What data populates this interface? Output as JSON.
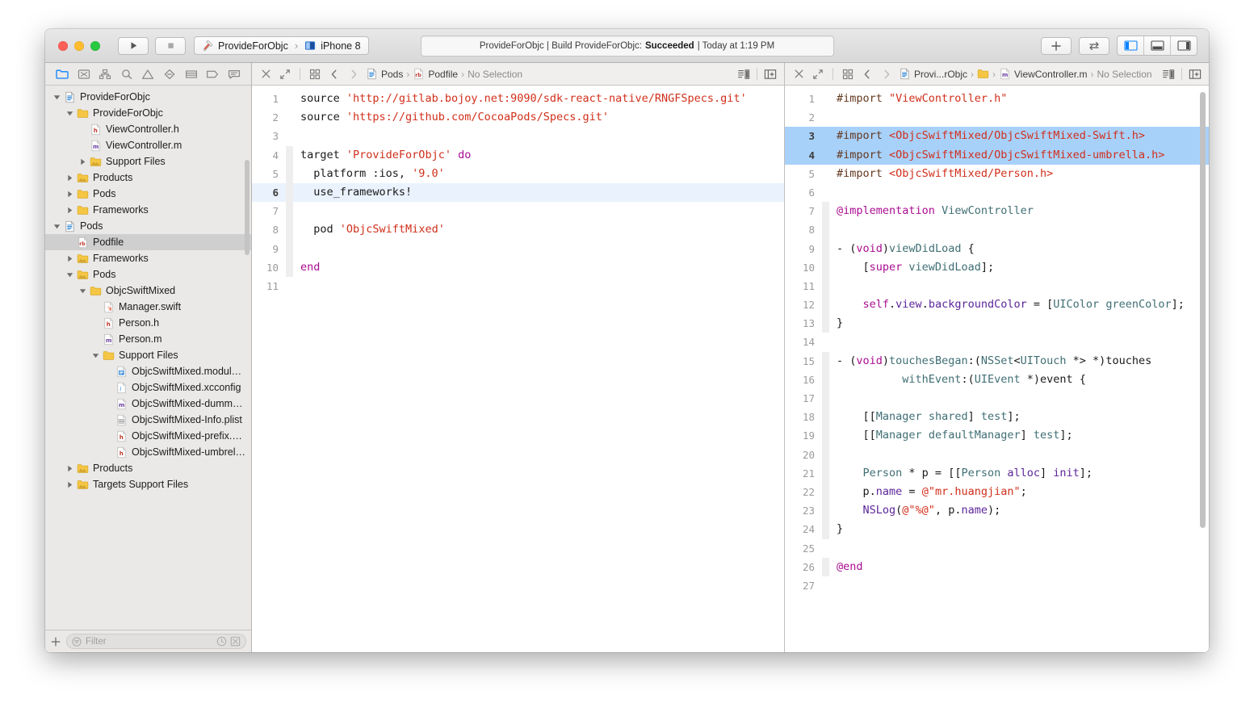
{
  "window": {
    "title": "ProvideForObjc",
    "traffic_lights": [
      "close-button",
      "minimize-button",
      "zoom-button"
    ]
  },
  "toolbar": {
    "run_label": "Run",
    "stop_label": "Stop",
    "scheme": {
      "project": "ProvideForObjc",
      "separator": "›",
      "destination": "iPhone 8"
    },
    "status": {
      "prefix": "ProvideForObjc | Build ProvideForObjc:",
      "result": "Succeeded",
      "suffix": "| Today at 1:19 PM"
    },
    "add_label": "+",
    "editor_buttons": [
      "navigator-toggle",
      "debug-toggle",
      "utilities-toggle"
    ]
  },
  "navigator": {
    "toolbar_icons": [
      "project-navigator-icon",
      "source-control-navigator-icon",
      "symbol-navigator-icon",
      "find-navigator-icon",
      "issue-navigator-icon",
      "test-navigator-icon",
      "debug-navigator-icon",
      "breakpoint-navigator-icon",
      "report-navigator-icon"
    ],
    "tree": [
      {
        "label": "ProvideForObjc",
        "depth": 0,
        "twisty": "open",
        "icon": "project",
        "selected": false
      },
      {
        "label": "ProvideForObjc",
        "depth": 1,
        "twisty": "open",
        "icon": "folder",
        "selected": false
      },
      {
        "label": "ViewController.h",
        "depth": 2,
        "twisty": "none",
        "icon": "header",
        "selected": false
      },
      {
        "label": "ViewController.m",
        "depth": 2,
        "twisty": "none",
        "icon": "objc",
        "selected": false
      },
      {
        "label": "Support Files",
        "depth": 2,
        "twisty": "closed",
        "icon": "folder-g",
        "selected": false
      },
      {
        "label": "Products",
        "depth": 1,
        "twisty": "closed",
        "icon": "folder-g",
        "selected": false
      },
      {
        "label": "Pods",
        "depth": 1,
        "twisty": "closed",
        "icon": "folder",
        "selected": false
      },
      {
        "label": "Frameworks",
        "depth": 1,
        "twisty": "closed",
        "icon": "folder",
        "selected": false
      },
      {
        "label": "Pods",
        "depth": 0,
        "twisty": "open",
        "icon": "project",
        "selected": false
      },
      {
        "label": "Podfile",
        "depth": 1,
        "twisty": "none",
        "icon": "ruby",
        "selected": true
      },
      {
        "label": "Frameworks",
        "depth": 1,
        "twisty": "closed",
        "icon": "folder-g",
        "selected": false
      },
      {
        "label": "Pods",
        "depth": 1,
        "twisty": "open",
        "icon": "folder-g",
        "selected": false
      },
      {
        "label": "ObjcSwiftMixed",
        "depth": 2,
        "twisty": "open",
        "icon": "folder",
        "selected": false
      },
      {
        "label": "Manager.swift",
        "depth": 3,
        "twisty": "none",
        "icon": "swift",
        "selected": false
      },
      {
        "label": "Person.h",
        "depth": 3,
        "twisty": "none",
        "icon": "header",
        "selected": false
      },
      {
        "label": "Person.m",
        "depth": 3,
        "twisty": "none",
        "icon": "objc",
        "selected": false
      },
      {
        "label": "Support Files",
        "depth": 3,
        "twisty": "open",
        "icon": "folder",
        "selected": false
      },
      {
        "label": "ObjcSwiftMixed.modulemap",
        "depth": 4,
        "twisty": "none",
        "icon": "module",
        "selected": false
      },
      {
        "label": "ObjcSwiftMixed.xcconfig",
        "depth": 4,
        "twisty": "none",
        "icon": "xcconfig",
        "selected": false
      },
      {
        "label": "ObjcSwiftMixed-dummy.m",
        "depth": 4,
        "twisty": "none",
        "icon": "objc",
        "selected": false
      },
      {
        "label": "ObjcSwiftMixed-Info.plist",
        "depth": 4,
        "twisty": "none",
        "icon": "plist",
        "selected": false
      },
      {
        "label": "ObjcSwiftMixed-prefix.pch",
        "depth": 4,
        "twisty": "none",
        "icon": "header",
        "selected": false
      },
      {
        "label": "ObjcSwiftMixed-umbrella.h",
        "depth": 4,
        "twisty": "none",
        "icon": "header",
        "selected": false
      },
      {
        "label": "Products",
        "depth": 1,
        "twisty": "closed",
        "icon": "folder-g",
        "selected": false
      },
      {
        "label": "Targets Support Files",
        "depth": 1,
        "twisty": "closed",
        "icon": "folder-g",
        "selected": false
      }
    ],
    "filter": {
      "placeholder": "Filter",
      "add_label": "+",
      "recent_icon": "clock-icon",
      "source-control_icon": "source-control-filter-icon"
    }
  },
  "left_editor": {
    "jumpbar": {
      "close_icon": "close-icon",
      "expand_icon": "expand-icon",
      "related_icon": "related-items-icon",
      "back_icon": "chevron-left-icon",
      "forward_icon": "chevron-right-icon",
      "crumbs": [
        {
          "label": "Pods",
          "icon": "project"
        },
        {
          "label": "Podfile",
          "icon": "ruby"
        },
        {
          "label": "No Selection",
          "icon": "none"
        }
      ],
      "assistant_icon": "minimap-icon",
      "split_icon": "add-editor-icon"
    },
    "filename": "Podfile",
    "lines": [
      {
        "n": 1,
        "hl": false,
        "fold": false,
        "tokens": [
          {
            "t": "source ",
            "c": "plain"
          },
          {
            "t": "'http://gitlab.bojoy.net:9090/sdk-react-native/RNGFSpecs.git'",
            "c": "str"
          }
        ]
      },
      {
        "n": 2,
        "hl": false,
        "fold": false,
        "tokens": [
          {
            "t": "source ",
            "c": "plain"
          },
          {
            "t": "'https://github.com/CocoaPods/Specs.git'",
            "c": "str"
          }
        ]
      },
      {
        "n": 3,
        "hl": false,
        "fold": false,
        "tokens": []
      },
      {
        "n": 4,
        "hl": false,
        "fold": true,
        "tokens": [
          {
            "t": "target ",
            "c": "plain"
          },
          {
            "t": "'ProvideForObjc'",
            "c": "str"
          },
          {
            "t": " ",
            "c": "plain"
          },
          {
            "t": "do",
            "c": "kw"
          }
        ]
      },
      {
        "n": 5,
        "hl": false,
        "fold": true,
        "tokens": [
          {
            "t": "  platform :ios, ",
            "c": "plain"
          },
          {
            "t": "'9.0'",
            "c": "str"
          }
        ]
      },
      {
        "n": 6,
        "hl": true,
        "fold": true,
        "tokens": [
          {
            "t": "  use_frameworks!",
            "c": "plain"
          }
        ]
      },
      {
        "n": 7,
        "hl": false,
        "fold": true,
        "tokens": []
      },
      {
        "n": 8,
        "hl": false,
        "fold": true,
        "tokens": [
          {
            "t": "  pod ",
            "c": "plain"
          },
          {
            "t": "'ObjcSwiftMixed'",
            "c": "str"
          }
        ]
      },
      {
        "n": 9,
        "hl": false,
        "fold": true,
        "tokens": []
      },
      {
        "n": 10,
        "hl": false,
        "fold": true,
        "tokens": [
          {
            "t": "end",
            "c": "kw"
          }
        ]
      },
      {
        "n": 11,
        "hl": false,
        "fold": false,
        "tokens": []
      }
    ]
  },
  "right_editor": {
    "jumpbar": {
      "close_icon": "close-icon",
      "expand_icon": "expand-icon",
      "related_icon": "related-items-icon",
      "back_icon": "chevron-left-icon",
      "forward_icon": "chevron-right-icon",
      "crumbs": [
        {
          "label": "Provi...rObjc",
          "icon": "project"
        },
        {
          "label": "",
          "icon": "folder"
        },
        {
          "label": "ViewController.m",
          "icon": "objc"
        },
        {
          "label": "No Selection",
          "icon": "none"
        }
      ],
      "assistant_icon": "minimap-icon",
      "split_icon": "add-editor-icon"
    },
    "filename": "ViewController.m",
    "lines": [
      {
        "n": 1,
        "sel": false,
        "fold": false,
        "bold": false,
        "tokens": [
          {
            "t": "#import ",
            "c": "pre"
          },
          {
            "t": "\"ViewController.h\"",
            "c": "str"
          }
        ]
      },
      {
        "n": 2,
        "sel": false,
        "fold": false,
        "bold": false,
        "tokens": []
      },
      {
        "n": 3,
        "sel": true,
        "fold": false,
        "bold": true,
        "tokens": [
          {
            "t": "#import ",
            "c": "pre"
          },
          {
            "t": "<ObjcSwiftMixed/ObjcSwiftMixed-Swift.h>",
            "c": "str"
          }
        ]
      },
      {
        "n": 4,
        "sel": true,
        "fold": false,
        "bold": true,
        "tokens": [
          {
            "t": "#import ",
            "c": "pre"
          },
          {
            "t": "<ObjcSwiftMixed/ObjcSwiftMixed-umbrella.h>",
            "c": "str"
          }
        ]
      },
      {
        "n": 5,
        "sel": false,
        "fold": false,
        "bold": false,
        "tokens": [
          {
            "t": "#import ",
            "c": "pre"
          },
          {
            "t": "<ObjcSwiftMixed/Person.h>",
            "c": "str"
          }
        ]
      },
      {
        "n": 6,
        "sel": false,
        "fold": false,
        "bold": false,
        "tokens": []
      },
      {
        "n": 7,
        "sel": false,
        "fold": true,
        "bold": false,
        "tokens": [
          {
            "t": "@implementation",
            "c": "kw"
          },
          {
            "t": " ",
            "c": "plain"
          },
          {
            "t": "ViewController",
            "c": "type"
          }
        ]
      },
      {
        "n": 8,
        "sel": false,
        "fold": true,
        "bold": false,
        "tokens": []
      },
      {
        "n": 9,
        "sel": false,
        "fold": true,
        "bold": false,
        "tokens": [
          {
            "t": "- (",
            "c": "plain"
          },
          {
            "t": "void",
            "c": "kw"
          },
          {
            "t": ")",
            "c": "plain"
          },
          {
            "t": "viewDidLoad",
            "c": "type"
          },
          {
            "t": " {",
            "c": "plain"
          }
        ]
      },
      {
        "n": 10,
        "sel": false,
        "fold": true,
        "bold": false,
        "tokens": [
          {
            "t": "    [",
            "c": "plain"
          },
          {
            "t": "super",
            "c": "kw"
          },
          {
            "t": " ",
            "c": "plain"
          },
          {
            "t": "viewDidLoad",
            "c": "type"
          },
          {
            "t": "];",
            "c": "plain"
          }
        ]
      },
      {
        "n": 11,
        "sel": false,
        "fold": true,
        "bold": false,
        "tokens": []
      },
      {
        "n": 12,
        "sel": false,
        "fold": true,
        "bold": false,
        "tokens": [
          {
            "t": "    ",
            "c": "plain"
          },
          {
            "t": "self",
            "c": "kw"
          },
          {
            "t": ".",
            "c": "plain"
          },
          {
            "t": "view",
            "c": "cls"
          },
          {
            "t": ".",
            "c": "plain"
          },
          {
            "t": "backgroundColor",
            "c": "cls"
          },
          {
            "t": " = [",
            "c": "plain"
          },
          {
            "t": "UIColor",
            "c": "type"
          },
          {
            "t": " ",
            "c": "plain"
          },
          {
            "t": "greenColor",
            "c": "type"
          },
          {
            "t": "];",
            "c": "plain"
          }
        ]
      },
      {
        "n": 13,
        "sel": false,
        "fold": true,
        "bold": false,
        "tokens": [
          {
            "t": "}",
            "c": "plain"
          }
        ]
      },
      {
        "n": 14,
        "sel": false,
        "fold": false,
        "bold": false,
        "tokens": []
      },
      {
        "n": 15,
        "sel": false,
        "fold": true,
        "bold": false,
        "tokens": [
          {
            "t": "- (",
            "c": "plain"
          },
          {
            "t": "void",
            "c": "kw"
          },
          {
            "t": ")",
            "c": "plain"
          },
          {
            "t": "touchesBegan",
            "c": "type"
          },
          {
            "t": ":(",
            "c": "plain"
          },
          {
            "t": "NSSet",
            "c": "type"
          },
          {
            "t": "<",
            "c": "plain"
          },
          {
            "t": "UITouch",
            "c": "type"
          },
          {
            "t": " *> *)touches",
            "c": "plain"
          }
        ]
      },
      {
        "n": 16,
        "sel": false,
        "fold": true,
        "bold": false,
        "tokens": [
          {
            "t": "          ",
            "c": "plain"
          },
          {
            "t": "withEvent",
            "c": "type"
          },
          {
            "t": ":(",
            "c": "plain"
          },
          {
            "t": "UIEvent",
            "c": "type"
          },
          {
            "t": " *)event {",
            "c": "plain"
          }
        ]
      },
      {
        "n": 17,
        "sel": false,
        "fold": true,
        "bold": false,
        "tokens": []
      },
      {
        "n": 18,
        "sel": false,
        "fold": true,
        "bold": false,
        "tokens": [
          {
            "t": "    [[",
            "c": "plain"
          },
          {
            "t": "Manager",
            "c": "type"
          },
          {
            "t": " ",
            "c": "plain"
          },
          {
            "t": "shared",
            "c": "type"
          },
          {
            "t": "] ",
            "c": "plain"
          },
          {
            "t": "test",
            "c": "type"
          },
          {
            "t": "];",
            "c": "plain"
          }
        ]
      },
      {
        "n": 19,
        "sel": false,
        "fold": true,
        "bold": false,
        "tokens": [
          {
            "t": "    [[",
            "c": "plain"
          },
          {
            "t": "Manager",
            "c": "type"
          },
          {
            "t": " ",
            "c": "plain"
          },
          {
            "t": "defaultManager",
            "c": "type"
          },
          {
            "t": "] ",
            "c": "plain"
          },
          {
            "t": "test",
            "c": "type"
          },
          {
            "t": "];",
            "c": "plain"
          }
        ]
      },
      {
        "n": 20,
        "sel": false,
        "fold": true,
        "bold": false,
        "tokens": []
      },
      {
        "n": 21,
        "sel": false,
        "fold": true,
        "bold": false,
        "tokens": [
          {
            "t": "    ",
            "c": "plain"
          },
          {
            "t": "Person",
            "c": "type"
          },
          {
            "t": " * p = [[",
            "c": "plain"
          },
          {
            "t": "Person",
            "c": "type"
          },
          {
            "t": " ",
            "c": "plain"
          },
          {
            "t": "alloc",
            "c": "cls"
          },
          {
            "t": "] ",
            "c": "plain"
          },
          {
            "t": "init",
            "c": "cls"
          },
          {
            "t": "];",
            "c": "plain"
          }
        ]
      },
      {
        "n": 22,
        "sel": false,
        "fold": true,
        "bold": false,
        "tokens": [
          {
            "t": "    p.",
            "c": "plain"
          },
          {
            "t": "name",
            "c": "cls"
          },
          {
            "t": " = ",
            "c": "plain"
          },
          {
            "t": "@\"mr.huangjian\"",
            "c": "str"
          },
          {
            "t": ";",
            "c": "plain"
          }
        ]
      },
      {
        "n": 23,
        "sel": false,
        "fold": true,
        "bold": false,
        "tokens": [
          {
            "t": "    ",
            "c": "plain"
          },
          {
            "t": "NSLog",
            "c": "cls"
          },
          {
            "t": "(",
            "c": "plain"
          },
          {
            "t": "@\"%@\"",
            "c": "str"
          },
          {
            "t": ", p.",
            "c": "plain"
          },
          {
            "t": "name",
            "c": "cls"
          },
          {
            "t": ");",
            "c": "plain"
          }
        ]
      },
      {
        "n": 24,
        "sel": false,
        "fold": true,
        "bold": false,
        "tokens": [
          {
            "t": "}",
            "c": "plain"
          }
        ]
      },
      {
        "n": 25,
        "sel": false,
        "fold": false,
        "bold": false,
        "tokens": []
      },
      {
        "n": 26,
        "sel": false,
        "fold": true,
        "bold": false,
        "tokens": [
          {
            "t": "@end",
            "c": "kw"
          }
        ]
      },
      {
        "n": 27,
        "sel": false,
        "fold": false,
        "bold": false,
        "tokens": []
      }
    ]
  },
  "colors": {
    "selection": "#a8d1fa",
    "current_line": "#eaf2fd",
    "string": "#d12f1b",
    "keyword": "#aa0d91",
    "type": "#3f6e74",
    "class_member": "#5c2699",
    "preprocessor": "#643820",
    "sidebar_bg": "#ebe9e7",
    "row_selected": "#cfcfcf",
    "accent_blue": "#1a8cff"
  }
}
